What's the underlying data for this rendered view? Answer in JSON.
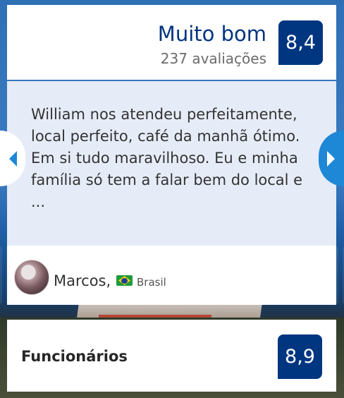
{
  "summary": {
    "rating_label": "Muito bom",
    "review_count": "237 avaliações",
    "score": "8,4"
  },
  "review": {
    "text": "William nos atendeu perfeitamente, local perfeito, café da manhã ótimo. Em si tudo maravilhoso. Eu e minha família só tem a falar bem do local e ...",
    "reviewer_name": "Marcos,",
    "reviewer_country": "Brasil",
    "flag_icon": "brazil-flag-icon"
  },
  "carousel": {
    "prev_icon": "chevron-left-icon",
    "next_icon": "chevron-right-icon",
    "accent_color": "#1e88d6"
  },
  "category": {
    "label": "Funcionários",
    "score": "8,9"
  },
  "colors": {
    "brand_blue": "#003580",
    "panel_bg": "#e6ecf7"
  }
}
